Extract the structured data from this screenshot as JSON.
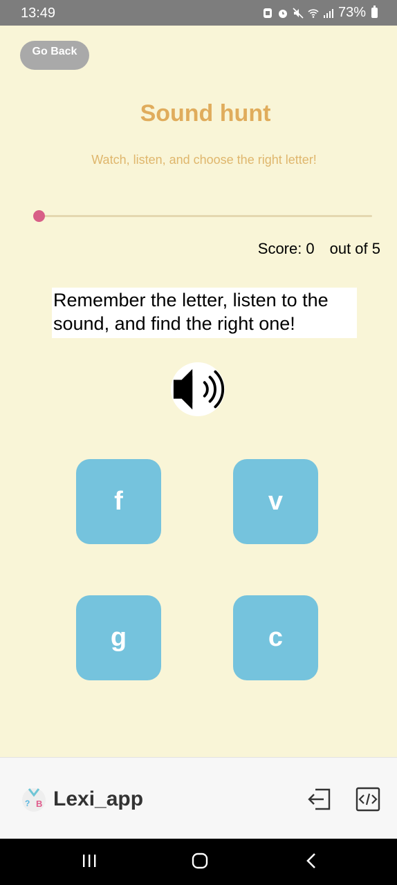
{
  "status_bar": {
    "time": "13:49",
    "battery": "73%",
    "icons": [
      "notification-icon",
      "alarm-icon",
      "mute-icon",
      "wifi-icon",
      "signal-icon",
      "battery-icon"
    ]
  },
  "screen": {
    "back_label": "Go Back",
    "title": "Sound hunt",
    "subtitle": "Watch, listen, and choose the right letter!",
    "progress": 0,
    "score_label": "Score:",
    "score_value": "0",
    "score_total": "out of 5",
    "instruction": "Remember the letter, listen to the sound, and find the right one!",
    "speaker_icon": "speaker-icon",
    "letters": [
      "f",
      "v",
      "g",
      "c"
    ]
  },
  "app_bar": {
    "app_name": "Lexi_app",
    "icons": [
      "exit-icon",
      "code-icon"
    ]
  },
  "nav_bar": {
    "icons": [
      "recents-icon",
      "home-icon",
      "back-icon"
    ]
  },
  "colors": {
    "background": "#f9f5d7",
    "title": "#e0ac5c",
    "letter_button": "#75c3dd",
    "progress_thumb": "#d85f87",
    "go_back_button": "#a9a9a9"
  }
}
